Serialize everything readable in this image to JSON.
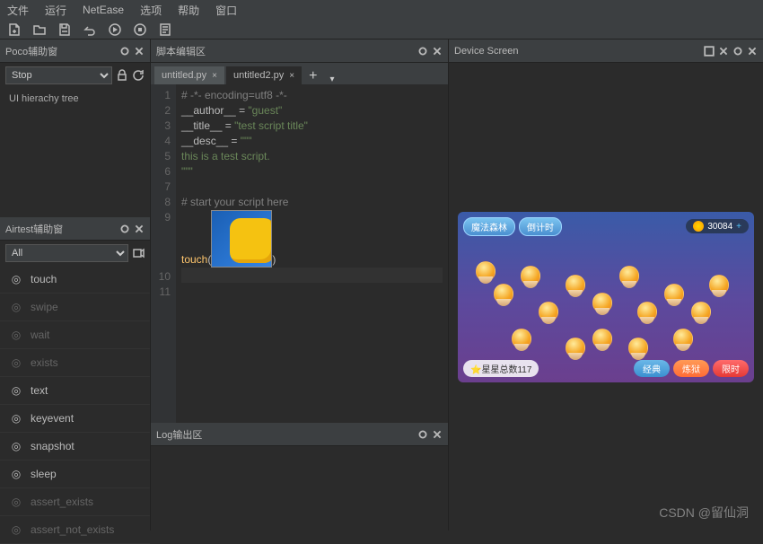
{
  "menu": {
    "items": [
      "文件",
      "运行",
      "NetEase",
      "选项",
      "帮助",
      "窗口"
    ]
  },
  "panels": {
    "poco": {
      "title": "Poco辅助窗",
      "dropdown": "Stop",
      "hierarchy": "UI hierachy tree"
    },
    "airtest": {
      "title": "Airtest辅助窗",
      "filter": "All",
      "items": [
        {
          "label": "touch",
          "dim": false
        },
        {
          "label": "swipe",
          "dim": true
        },
        {
          "label": "wait",
          "dim": true
        },
        {
          "label": "exists",
          "dim": true
        },
        {
          "label": "text",
          "dim": false
        },
        {
          "label": "keyevent",
          "dim": false
        },
        {
          "label": "snapshot",
          "dim": false
        },
        {
          "label": "sleep",
          "dim": false
        },
        {
          "label": "assert_exists",
          "dim": true
        },
        {
          "label": "assert_not_exists",
          "dim": true
        }
      ]
    },
    "editor": {
      "title": "脚本编辑区"
    },
    "log": {
      "title": "Log输出区"
    },
    "device": {
      "title": "Device Screen"
    }
  },
  "tabs": [
    {
      "name": "untitled.py",
      "active": false
    },
    {
      "name": "untitled2.py",
      "active": true
    }
  ],
  "code": {
    "l1": "# -*- encoding=utf8 -*-",
    "l2a": "__author__",
    "l2b": " = ",
    "l2c": "\"guest\"",
    "l3a": "__title__",
    "l3b": " = ",
    "l3c": "\"test script title\"",
    "l4a": "__desc__",
    "l4b": " = ",
    "l4c": "\"\"\"",
    "l5": "this is a test script.",
    "l6": "\"\"\"",
    "l8": "# start your script here",
    "l9a": "touch",
    "l9b": "(",
    "l9c": ")"
  },
  "lines": [
    "1",
    "2",
    "3",
    "4",
    "5",
    "6",
    "7",
    "8",
    "9",
    "10",
    "11"
  ],
  "game": {
    "top_btn1": "魔法森林",
    "top_btn2": "倒计时",
    "coins": "30084",
    "stars": "星星总数117",
    "modes": [
      "经典",
      "炼狱",
      "限时"
    ]
  },
  "watermark": "CSDN @留仙洞"
}
